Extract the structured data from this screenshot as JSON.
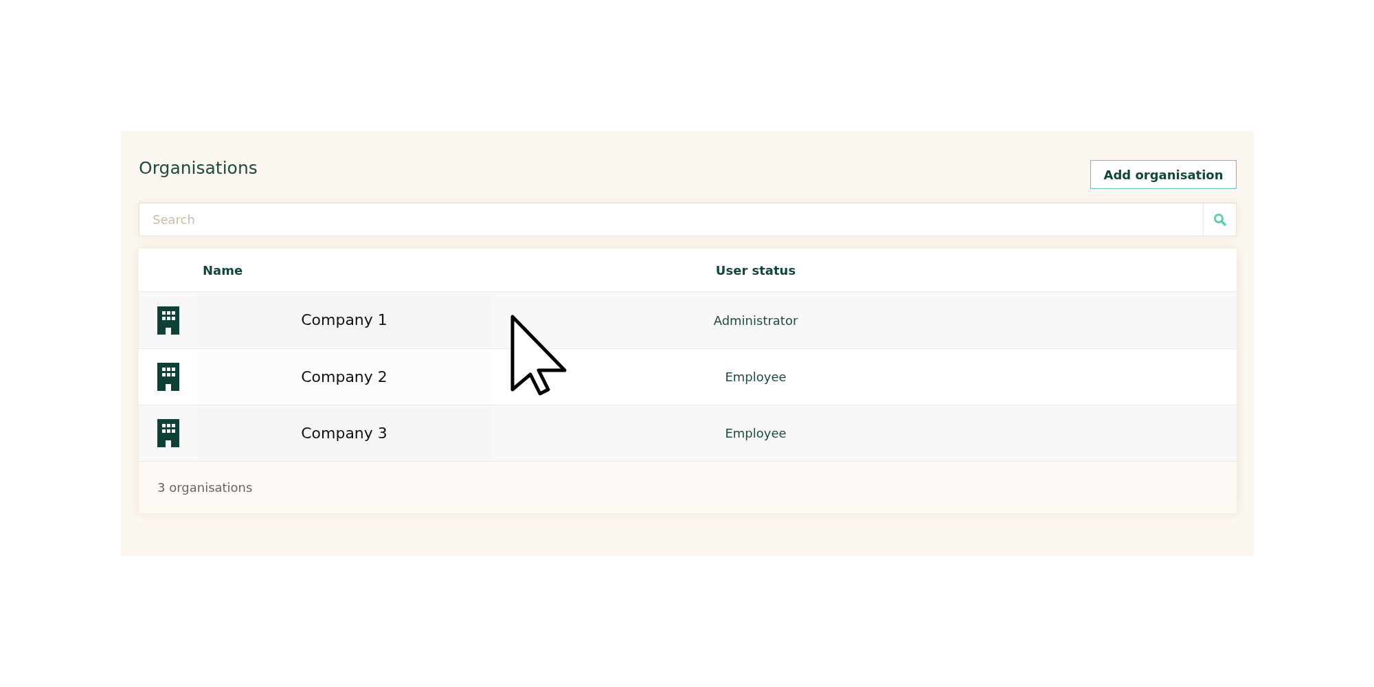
{
  "panel": {
    "title": "Organisations",
    "add_button": "Add organisation"
  },
  "search": {
    "placeholder": "Search"
  },
  "table": {
    "columns": [
      "Name",
      "User status"
    ],
    "rows": [
      {
        "name": "Company 1",
        "status": "Administrator"
      },
      {
        "name": "Company 2",
        "status": "Employee"
      },
      {
        "name": "Company 3",
        "status": "Employee"
      }
    ],
    "footer": "3 organisations"
  }
}
